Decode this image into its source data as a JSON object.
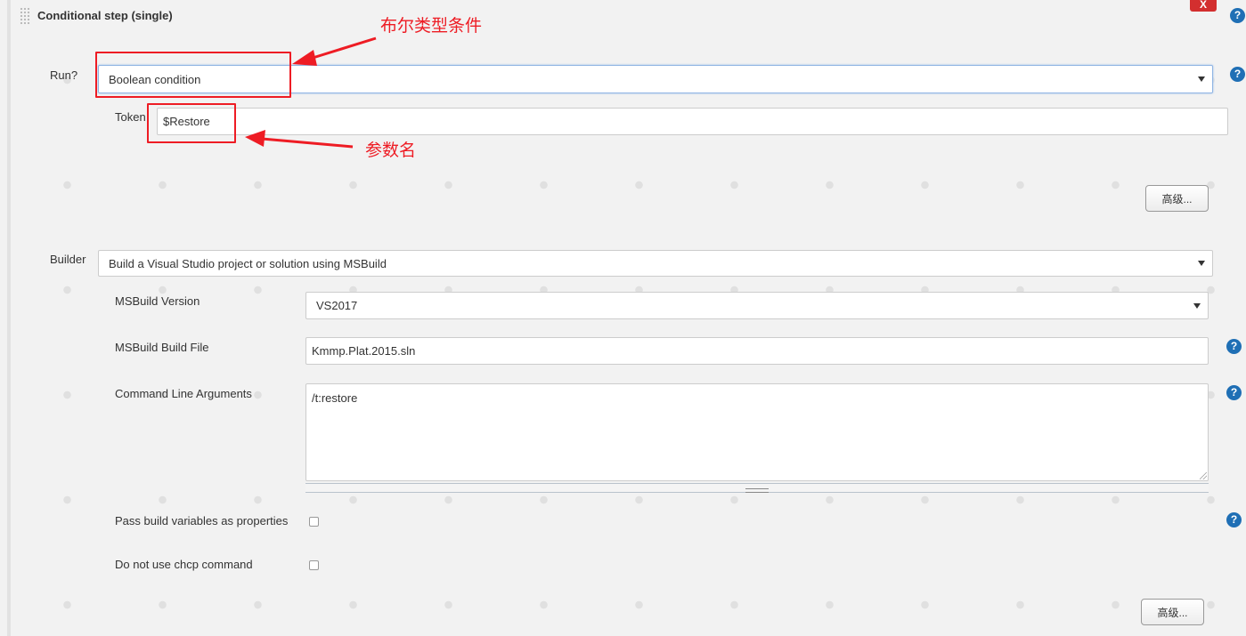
{
  "step": {
    "title": "Conditional step (single)",
    "close_label": "X",
    "help_label": "?"
  },
  "run": {
    "label": "Run?",
    "selected": "Boolean condition"
  },
  "token": {
    "label": "Token",
    "value": "$Restore"
  },
  "advanced_label": "高级...",
  "builder": {
    "label": "Builder",
    "selected": "Build a Visual Studio project or solution using MSBuild"
  },
  "msbuild": {
    "version_label": "MSBuild Version",
    "version_selected": "VS2017",
    "build_file_label": "MSBuild Build File",
    "build_file_value": "Kmmp.Plat.2015.sln",
    "args_label": "Command Line Arguments",
    "args_value": "/t:restore",
    "pass_vars_label": "Pass build variables as properties",
    "no_chcp_label": "Do not use chcp command"
  },
  "annotations": {
    "boolean_type": "布尔类型条件",
    "param_name": "参数名",
    "color": "#ee1c24"
  },
  "colors": {
    "help": "#1f6fb5",
    "close": "#d32f2f"
  }
}
